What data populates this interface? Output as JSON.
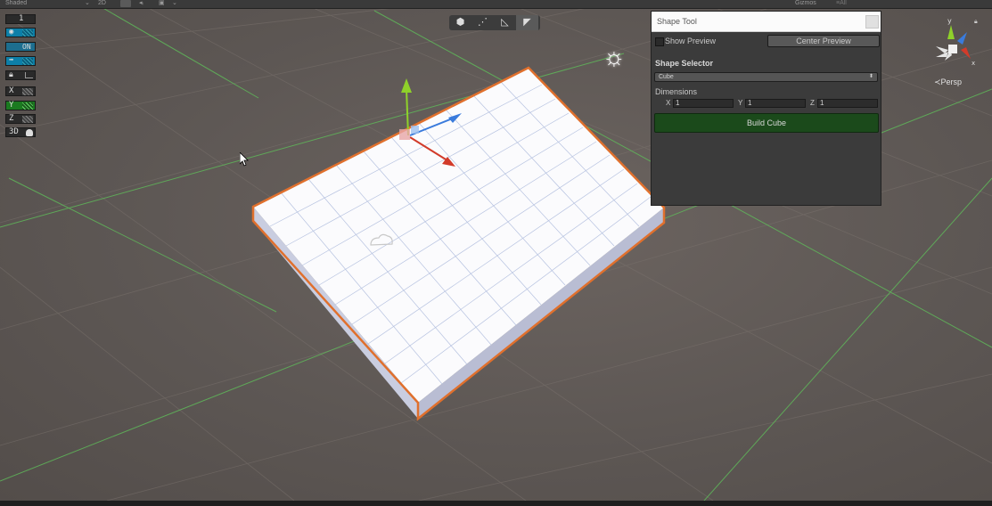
{
  "toolbar": {
    "shading_mode": "Shaded",
    "mode_2d": "2D",
    "gizmos_label": "Gizmos",
    "search_placeholder": "≡All"
  },
  "left_toolbar": {
    "layer_label": "1",
    "on_label": "ON",
    "x_label": "X",
    "y_label": "Y",
    "z_label": "Z",
    "view_3d_label": "3D"
  },
  "scene_modes": [
    "cube-mode-icon",
    "vertex-mode-icon",
    "edge-mode-icon",
    "face-mode-icon"
  ],
  "shape_tool": {
    "window_title": "Shape Tool",
    "show_preview_label": "Show Preview",
    "show_preview_checked": false,
    "center_preview_label": "Center Preview",
    "shape_selector_label": "Shape Selector",
    "shape_selected": "Cube",
    "dimensions_label": "Dimensions",
    "x_label": "X",
    "x_value": "1",
    "y_label": "Y",
    "y_value": "1",
    "z_label": "Z",
    "z_value": "1",
    "build_label": "Build Cube",
    "build_color": "#1b4a1b"
  },
  "view_gizmo": {
    "projection_label": "≺Persp",
    "axis_colors": {
      "x": "#d23b2a",
      "y": "#8fd12a",
      "z": "#3a7bdc"
    }
  },
  "colors": {
    "selection_outline": "#e0702d",
    "grid_axis_line": "#5fbd5a",
    "scene_background": "#5d5754"
  }
}
